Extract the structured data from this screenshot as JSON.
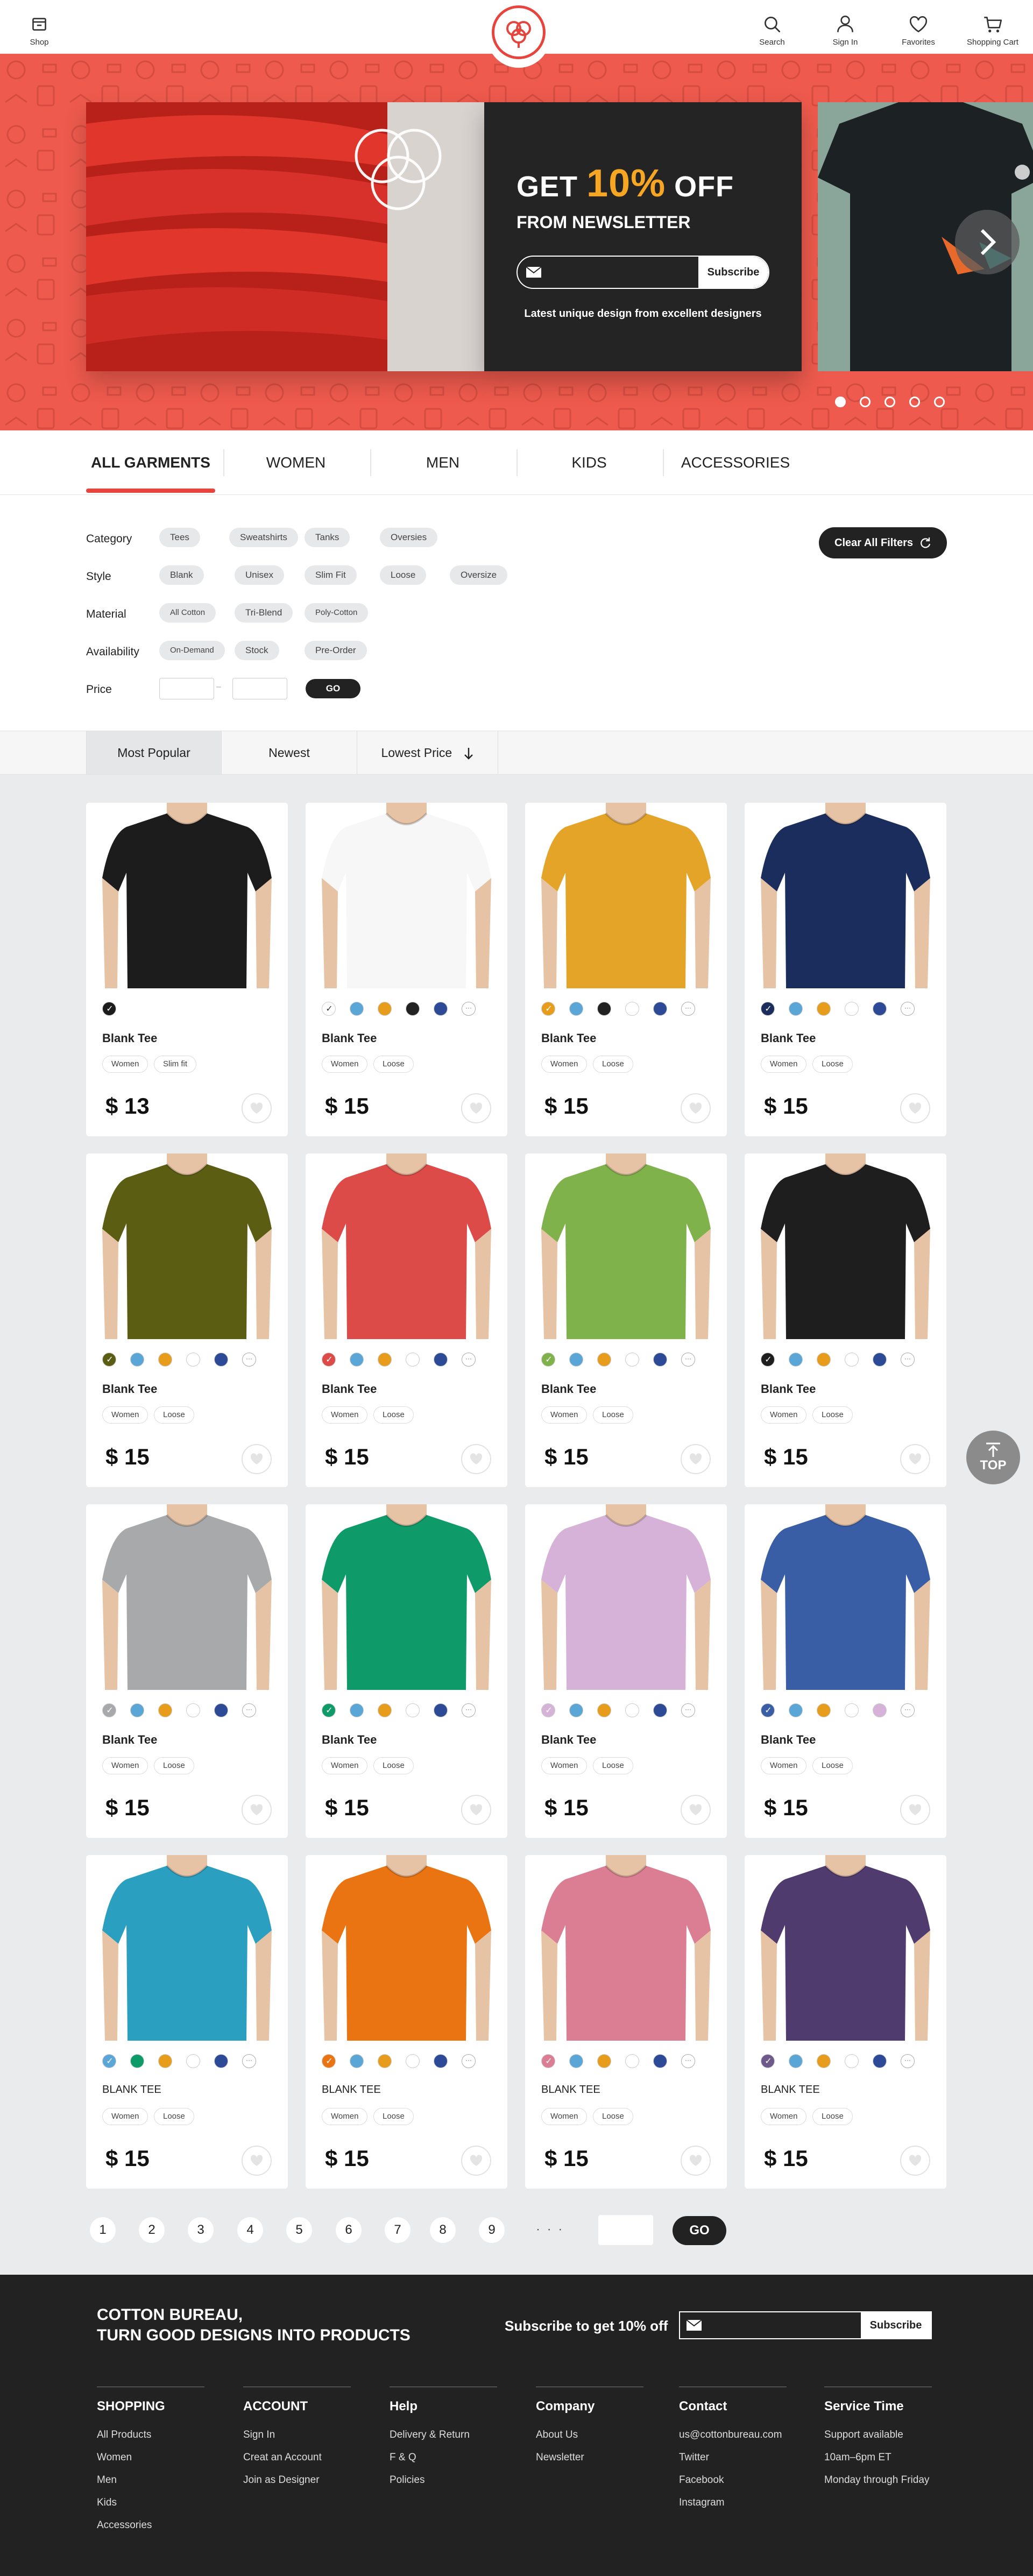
{
  "header": {
    "shop_label": "Shop",
    "search_label": "Search",
    "signin_label": "Sign In",
    "favorites_label": "Favorites",
    "cart_label": "Shopping Cart"
  },
  "banner": {
    "get_text": "GET",
    "percent_text": "10%",
    "off_text": "OFF",
    "from_text": "FROM NEWSLETTER",
    "subscribe_label": "Subscribe",
    "email_value": "",
    "note": "Latest unique design from excellent designers",
    "slides": 5,
    "active_slide": 1
  },
  "categories": [
    {
      "label": "ALL GARMENTS",
      "active": true
    },
    {
      "label": "WOMEN",
      "active": false
    },
    {
      "label": "MEN",
      "active": false
    },
    {
      "label": "KIDS",
      "active": false
    },
    {
      "label": "ACCESSORIES",
      "active": false
    }
  ],
  "filters": {
    "category": {
      "label": "Category",
      "options": [
        "Tees",
        "Sweatshirts",
        "Tanks",
        "Oversies"
      ]
    },
    "style": {
      "label": "Style",
      "options": [
        "Blank",
        "Unisex",
        "Slim Fit",
        "Loose",
        "Oversize"
      ]
    },
    "material": {
      "label": "Material",
      "options": [
        "All Cotton",
        "Tri-Blend",
        "Poly-Cotton"
      ]
    },
    "availability": {
      "label": "Availability",
      "options": [
        "On-Demand",
        "Stock",
        "Pre-Order"
      ]
    },
    "price": {
      "label": "Price",
      "min": "",
      "max": "",
      "separator": "–",
      "go_label": "GO"
    },
    "clear_label": "Clear All Filters"
  },
  "sort": {
    "tabs": [
      "Most Popular",
      "Newest",
      "Lowest Price"
    ],
    "active": 0
  },
  "colors": {
    "accent": "#e6443d",
    "banner_bg": "#ee5a4d",
    "dark": "#222222",
    "highlight": "#f6a623"
  },
  "products": [
    {
      "name": "Blank Tee",
      "tags": [
        "Women",
        "Slim fit"
      ],
      "price": "$ 13",
      "shirt": "#1c1c1c",
      "swatches": [
        "#1c1c1c"
      ],
      "sel": 0
    },
    {
      "name": "Blank Tee",
      "tags": [
        "Women",
        "Loose"
      ],
      "price": "$ 15",
      "shirt": "#f7f7f7",
      "swatches": [
        "#ffffff",
        "#5aa6d6",
        "#e89c1c",
        "#222222",
        "#2c4a96"
      ],
      "sel": 0
    },
    {
      "name": "Blank Tee",
      "tags": [
        "Women",
        "Loose"
      ],
      "price": "$ 15",
      "shirt": "#e3a427",
      "swatches": [
        "#e89c1c",
        "#5aa6d6",
        "#222222",
        "#ffffff",
        "#2c4a96"
      ],
      "sel": 0
    },
    {
      "name": "Blank Tee",
      "tags": [
        "Women",
        "Loose"
      ],
      "price": "$ 15",
      "shirt": "#1a2d5c",
      "swatches": [
        "#1a2d5c",
        "#5aa6d6",
        "#e89c1c",
        "#ffffff",
        "#2c4a96"
      ],
      "sel": 0
    },
    {
      "name": "Blank Tee",
      "tags": [
        "Women",
        "Loose"
      ],
      "price": "$ 15",
      "shirt": "#5b5e12",
      "swatches": [
        "#5b5e12",
        "#5aa6d6",
        "#e89c1c",
        "#ffffff",
        "#2c4a96"
      ],
      "sel": 0
    },
    {
      "name": "Blank Tee",
      "tags": [
        "Women",
        "Loose"
      ],
      "price": "$ 15",
      "shirt": "#dd4b48",
      "swatches": [
        "#dd4b48",
        "#5aa6d6",
        "#e89c1c",
        "#ffffff",
        "#2c4a96"
      ],
      "sel": 0
    },
    {
      "name": "Blank Tee",
      "tags": [
        "Women",
        "Loose"
      ],
      "price": "$ 15",
      "shirt": "#7fb24a",
      "swatches": [
        "#7fb24a",
        "#5aa6d6",
        "#e89c1c",
        "#ffffff",
        "#2c4a96"
      ],
      "sel": 0
    },
    {
      "name": "Blank Tee",
      "tags": [
        "Women",
        "Loose"
      ],
      "price": "$ 15",
      "shirt": "#1e1e1e",
      "swatches": [
        "#1e1e1e",
        "#5aa6d6",
        "#e89c1c",
        "#ffffff",
        "#2c4a96"
      ],
      "sel": 0
    },
    {
      "name": "Blank Tee",
      "tags": [
        "Women",
        "Loose"
      ],
      "price": "$ 15",
      "shirt": "#a8a9ab",
      "swatches": [
        "#a8a9ab",
        "#5aa6d6",
        "#e89c1c",
        "#ffffff",
        "#2c4a96"
      ],
      "sel": 0
    },
    {
      "name": "Blank Tee",
      "tags": [
        "Women",
        "Loose"
      ],
      "price": "$ 15",
      "shirt": "#0f9a6a",
      "swatches": [
        "#0f9a6a",
        "#5aa6d6",
        "#e89c1c",
        "#ffffff",
        "#2c4a96"
      ],
      "sel": 0
    },
    {
      "name": "Blank Tee",
      "tags": [
        "Women",
        "Loose"
      ],
      "price": "$ 15",
      "shirt": "#d6b2d8",
      "swatches": [
        "#d6b2d8",
        "#5aa6d6",
        "#e89c1c",
        "#ffffff",
        "#2c4a96"
      ],
      "sel": 0
    },
    {
      "name": "Blank Tee",
      "tags": [
        "Women",
        "Loose"
      ],
      "price": "$ 15",
      "shirt": "#3a5ea6",
      "swatches": [
        "#3a5ea6",
        "#5aa6d6",
        "#e89c1c",
        "#ffffff",
        "#d6b2d8"
      ],
      "sel": 0
    },
    {
      "name": "BLANK TEE",
      "tags": [
        "Women",
        "Loose"
      ],
      "price": "$ 15",
      "shirt": "#2a9fc0",
      "swatches": [
        "#5aa6d6",
        "#0f9a6a",
        "#e89c1c",
        "#ffffff",
        "#2c4a96"
      ],
      "sel": 0
    },
    {
      "name": "BLANK TEE",
      "tags": [
        "Women",
        "Loose"
      ],
      "price": "$ 15",
      "shirt": "#ea7411",
      "swatches": [
        "#ea7411",
        "#5aa6d6",
        "#e89c1c",
        "#ffffff",
        "#2c4a96"
      ],
      "sel": 0
    },
    {
      "name": "BLANK TEE",
      "tags": [
        "Women",
        "Loose"
      ],
      "price": "$ 15",
      "shirt": "#dc7e93",
      "swatches": [
        "#dc7e93",
        "#5aa6d6",
        "#e89c1c",
        "#ffffff",
        "#2c4a96"
      ],
      "sel": 0
    },
    {
      "name": "BLANK TEE",
      "tags": [
        "Women",
        "Loose"
      ],
      "price": "$ 15",
      "shirt": "#4f3b6e",
      "swatches": [
        "#6d5a8a",
        "#5aa6d6",
        "#e89c1c",
        "#ffffff",
        "#2c4a96"
      ],
      "sel": 0
    }
  ],
  "top_label": "TOP",
  "pagination": {
    "pages": [
      "1",
      "2",
      "3",
      "4",
      "5",
      "6",
      "7",
      "8",
      "9"
    ],
    "ellipsis": "· · ·",
    "go_label": "GO"
  },
  "footer": {
    "tagline_1": "COTTON BUREAU,",
    "tagline_2": "TURN GOOD DESIGNS INTO PRODUCTS",
    "subscribe_text": "Subscribe to get 10% off",
    "subscribe_label": "Subscribe",
    "columns": [
      {
        "title": "SHOPPING",
        "links": [
          "All Products",
          "Women",
          "Men",
          "Kids",
          "Accessories"
        ]
      },
      {
        "title": "ACCOUNT",
        "links": [
          "Sign In",
          "Creat an Account",
          "Join as Designer"
        ]
      },
      {
        "title": "Help",
        "links": [
          "Delivery & Return",
          "F & Q",
          "Policies"
        ]
      },
      {
        "title": "Company",
        "links": [
          "About Us",
          "Newsletter"
        ]
      },
      {
        "title": "Contact",
        "links": [
          "us@cottonbureau.com",
          "Twitter",
          "Facebook",
          "Instagram"
        ]
      },
      {
        "title": "Service Time",
        "links": [
          "Support available",
          "10am–6pm ET",
          "Monday through Friday"
        ]
      }
    ]
  }
}
